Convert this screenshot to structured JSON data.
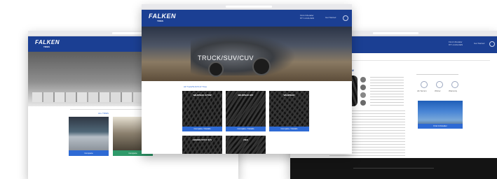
{
  "brand": {
    "logo": "FALKEN",
    "sub": "TIRES"
  },
  "center_window": {
    "hero_title": "TRUCK/SUV/CUV",
    "nav_lines": [
      "Find A Retailer",
      "877-4-FALKEN"
    ],
    "nav_link": "Get Started",
    "section_link": "All Truck/SUV/CUV Tires",
    "tiles": [
      {
        "title": "WILDPEAK A/T3W",
        "button": "Compare / Details"
      },
      {
        "title": "WILDPEAK M/T",
        "button": "Compare / Details"
      },
      {
        "title": "WILDPEAK",
        "button": "Compare / Details"
      },
      {
        "title": "AZENIS FK510 SUV",
        "button": ""
      },
      {
        "title": "ZIEX",
        "button": ""
      }
    ]
  },
  "left_window": {
    "section_link": "ALL TIRES",
    "buttons": [
      "Compare",
      "Compare"
    ]
  },
  "right_window": {
    "breadcrumb": "< Back to Truck/SUV/CUV",
    "product_title": "WILDPEAK A/T3W",
    "nav_lines": [
      "Find A Retailer",
      "877-4-FALKEN"
    ],
    "nav_link": "Get Started",
    "features": [
      "All-Terrain",
      "Winter",
      "Warranty"
    ],
    "cta": "Find A Retailer"
  },
  "colors": {
    "nav": "#1b3f93",
    "accent": "#2e6ad4",
    "button_green": "#2f9a6a"
  }
}
